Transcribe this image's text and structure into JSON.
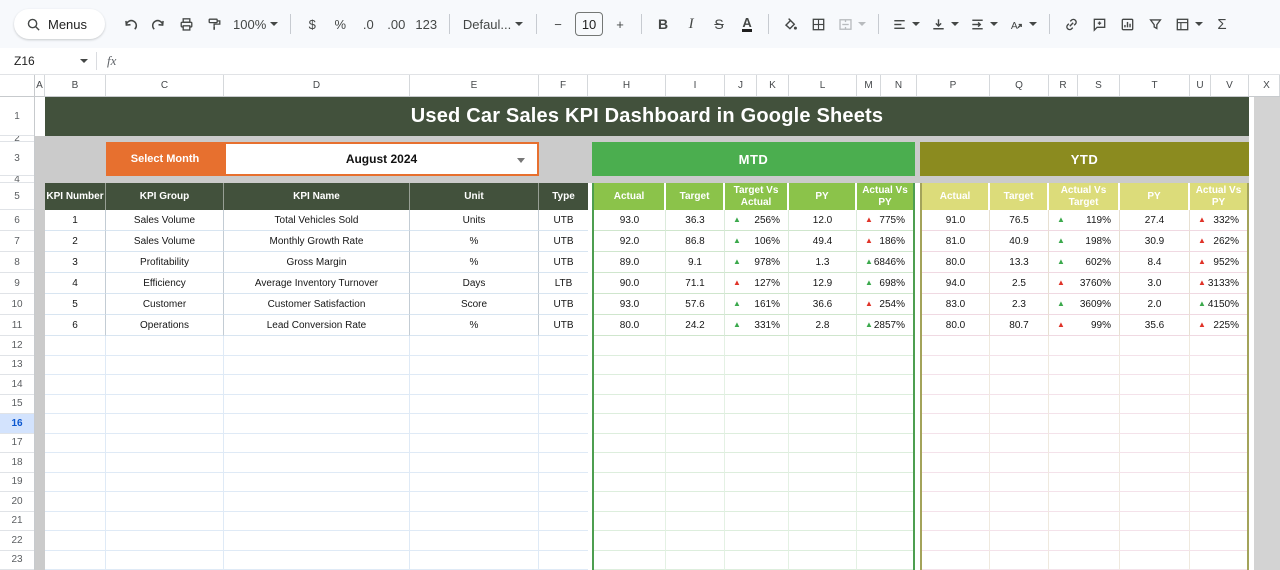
{
  "toolbar": {
    "menus": "Menus",
    "zoom": "100%",
    "currency": "$",
    "percent": "%",
    "decimal_decrease": ".0",
    "decimal_increase": ".00",
    "more_formats": "123",
    "font": "Defaul...",
    "font_size": "10",
    "minus": "−",
    "plus": "+",
    "bold": "B",
    "italic": "I",
    "strikethrough": "S",
    "text_color": "A",
    "functions": "Σ"
  },
  "formula_bar": {
    "cell_reference": "Z16",
    "fx": "fx"
  },
  "grid": {
    "column_letters": [
      "A",
      "B",
      "C",
      "D",
      "E",
      "F",
      "H",
      "I",
      "J",
      "K",
      "L",
      "M",
      "N",
      "P",
      "Q",
      "R",
      "S",
      "T",
      "U",
      "V",
      "X"
    ],
    "row_numbers": [
      1,
      2,
      3,
      4,
      5,
      6,
      7,
      8,
      9,
      10,
      11,
      12,
      13,
      14,
      15,
      16,
      17,
      18,
      19,
      20,
      21,
      22,
      23
    ],
    "selected_row": 16
  },
  "dashboard": {
    "title": "Used Car Sales KPI Dashboard in Google Sheets",
    "select_month_label": "Select Month",
    "selected_month": "August 2024",
    "up_arrow_glyph": "▲",
    "kpi_table": {
      "headers": [
        "KPI Number",
        "KPI Group",
        "KPI Name",
        "Unit",
        "Type"
      ],
      "rows": [
        [
          "1",
          "Sales Volume",
          "Total Vehicles Sold",
          "Units",
          "UTB"
        ],
        [
          "2",
          "Sales Volume",
          "Monthly Growth Rate",
          "%",
          "UTB"
        ],
        [
          "3",
          "Profitability",
          "Gross Margin",
          "%",
          "UTB"
        ],
        [
          "4",
          "Efficiency",
          "Average Inventory Turnover",
          "Days",
          "LTB"
        ],
        [
          "5",
          "Customer",
          "Customer Satisfaction",
          "Score",
          "UTB"
        ],
        [
          "6",
          "Operations",
          "Lead Conversion Rate",
          "%",
          "UTB"
        ]
      ]
    },
    "mtd": {
      "title": "MTD",
      "headers": [
        "Actual",
        "Target",
        "Target Vs Actual",
        "PY",
        "Actual Vs PY"
      ],
      "rows": [
        {
          "actual": "93.0",
          "target": "36.3",
          "vs1": "256%",
          "vs1_color": "green",
          "py": "12.0",
          "vs2": "775%",
          "vs2_color": "red"
        },
        {
          "actual": "92.0",
          "target": "86.8",
          "vs1": "106%",
          "vs1_color": "green",
          "py": "49.4",
          "vs2": "186%",
          "vs2_color": "red"
        },
        {
          "actual": "89.0",
          "target": "9.1",
          "vs1": "978%",
          "vs1_color": "green",
          "py": "1.3",
          "vs2": "6846%",
          "vs2_color": "green"
        },
        {
          "actual": "90.0",
          "target": "71.1",
          "vs1": "127%",
          "vs1_color": "red",
          "py": "12.9",
          "vs2": "698%",
          "vs2_color": "green"
        },
        {
          "actual": "93.0",
          "target": "57.6",
          "vs1": "161%",
          "vs1_color": "green",
          "py": "36.6",
          "vs2": "254%",
          "vs2_color": "red"
        },
        {
          "actual": "80.0",
          "target": "24.2",
          "vs1": "331%",
          "vs1_color": "green",
          "py": "2.8",
          "vs2": "2857%",
          "vs2_color": "green"
        }
      ]
    },
    "ytd": {
      "title": "YTD",
      "headers": [
        "Actual",
        "Target",
        "Actual Vs Target",
        "PY",
        "Actual Vs PY"
      ],
      "rows": [
        {
          "actual": "91.0",
          "target": "76.5",
          "vs1": "119%",
          "vs1_color": "green",
          "py": "27.4",
          "vs2": "332%",
          "vs2_color": "red"
        },
        {
          "actual": "81.0",
          "target": "40.9",
          "vs1": "198%",
          "vs1_color": "green",
          "py": "30.9",
          "vs2": "262%",
          "vs2_color": "red"
        },
        {
          "actual": "80.0",
          "target": "13.3",
          "vs1": "602%",
          "vs1_color": "green",
          "py": "8.4",
          "vs2": "952%",
          "vs2_color": "red"
        },
        {
          "actual": "94.0",
          "target": "2.5",
          "vs1": "3760%",
          "vs1_color": "red",
          "py": "3.0",
          "vs2": "3133%",
          "vs2_color": "red"
        },
        {
          "actual": "83.0",
          "target": "2.3",
          "vs1": "3609%",
          "vs1_color": "green",
          "py": "2.0",
          "vs2": "4150%",
          "vs2_color": "green"
        },
        {
          "actual": "80.0",
          "target": "80.7",
          "vs1": "99%",
          "vs1_color": "red",
          "py": "35.6",
          "vs2": "225%",
          "vs2_color": "red"
        }
      ]
    }
  },
  "colors": {
    "dark_green": "#42513C",
    "mtd_green": "#4BAE4F",
    "mtd_light_green": "#8BC34A",
    "ytd_olive": "#8B8B1F",
    "ytd_khaki": "#DCDC7A",
    "orange": "#E7702F",
    "positive_arrow": "#3BA94C",
    "negative_arrow": "#E03328"
  }
}
